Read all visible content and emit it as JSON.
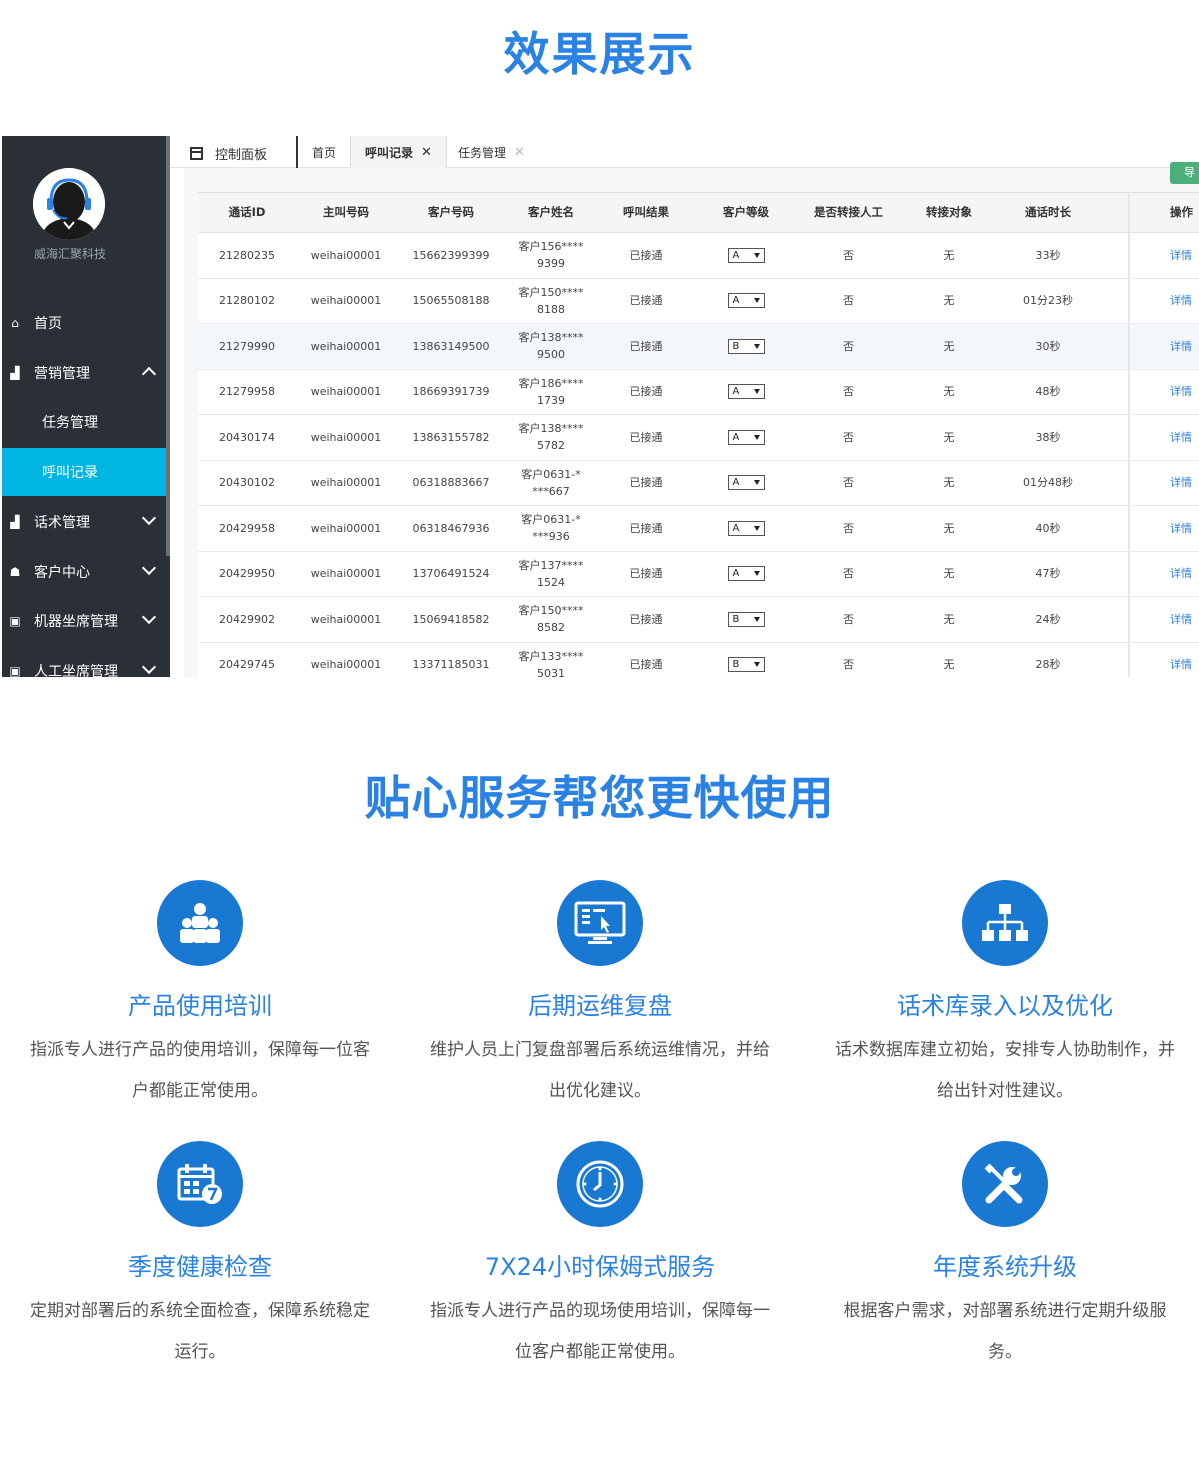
{
  "section1_title": "效果展示",
  "section2_title": "贴心服务帮您更快使用",
  "sidebar": {
    "company": "威海汇聚科技",
    "items": [
      {
        "label": "首页",
        "icon": "home-icon"
      },
      {
        "label": "营销管理",
        "icon": "chart-icon"
      },
      {
        "label": "任务管理"
      },
      {
        "label": "呼叫记录"
      },
      {
        "label": "话术管理",
        "icon": "chart-icon"
      },
      {
        "label": "客户中心",
        "icon": "users-icon"
      },
      {
        "label": "机器坐席管理",
        "icon": "robot-icon"
      },
      {
        "label": "人工坐席管理",
        "icon": "robot-icon"
      }
    ]
  },
  "tabbar": {
    "dashboard": "控制面板",
    "tabs": [
      "首页",
      "呼叫记录",
      "任务管理"
    ],
    "close_glyph": "✕",
    "green_button": "导"
  },
  "table": {
    "headers": [
      "通话ID",
      "主叫号码",
      "客户号码",
      "客户姓名",
      "呼叫结果",
      "客户等级",
      "是否转接人工",
      "转接对象",
      "通话时长",
      "操作"
    ],
    "rows": [
      {
        "id": "21280235",
        "caller": "weihai00001",
        "phone": "15662399399",
        "name1": "客户156****",
        "name2": "9399",
        "result": "已接通",
        "level": "A",
        "transfer": "否",
        "target": "无",
        "duration": "33秒",
        "action": "详情"
      },
      {
        "id": "21280102",
        "caller": "weihai00001",
        "phone": "15065508188",
        "name1": "客户150****",
        "name2": "8188",
        "result": "已接通",
        "level": "A",
        "transfer": "否",
        "target": "无",
        "duration": "01分23秒",
        "action": "详情"
      },
      {
        "id": "21279990",
        "caller": "weihai00001",
        "phone": "13863149500",
        "name1": "客户138****",
        "name2": "9500",
        "result": "已接通",
        "level": "B",
        "transfer": "否",
        "target": "无",
        "duration": "30秒",
        "action": "详情"
      },
      {
        "id": "21279958",
        "caller": "weihai00001",
        "phone": "18669391739",
        "name1": "客户186****",
        "name2": "1739",
        "result": "已接通",
        "level": "A",
        "transfer": "否",
        "target": "无",
        "duration": "48秒",
        "action": "详情"
      },
      {
        "id": "20430174",
        "caller": "weihai00001",
        "phone": "13863155782",
        "name1": "客户138****",
        "name2": "5782",
        "result": "已接通",
        "level": "A",
        "transfer": "否",
        "target": "无",
        "duration": "38秒",
        "action": "详情"
      },
      {
        "id": "20430102",
        "caller": "weihai00001",
        "phone": "06318883667",
        "name1": "客户0631-*",
        "name2": "***667",
        "result": "已接通",
        "level": "A",
        "transfer": "否",
        "target": "无",
        "duration": "01分48秒",
        "action": "详情"
      },
      {
        "id": "20429958",
        "caller": "weihai00001",
        "phone": "06318467936",
        "name1": "客户0631-*",
        "name2": "***936",
        "result": "已接通",
        "level": "A",
        "transfer": "否",
        "target": "无",
        "duration": "40秒",
        "action": "详情"
      },
      {
        "id": "20429950",
        "caller": "weihai00001",
        "phone": "13706491524",
        "name1": "客户137****",
        "name2": "1524",
        "result": "已接通",
        "level": "A",
        "transfer": "否",
        "target": "无",
        "duration": "47秒",
        "action": "详情"
      },
      {
        "id": "20429902",
        "caller": "weihai00001",
        "phone": "15069418582",
        "name1": "客户150****",
        "name2": "8582",
        "result": "已接通",
        "level": "B",
        "transfer": "否",
        "target": "无",
        "duration": "24秒",
        "action": "详情"
      },
      {
        "id": "20429745",
        "caller": "weihai00001",
        "phone": "13371185031",
        "name1": "客户133****",
        "name2": "5031",
        "result": "已接通",
        "level": "B",
        "transfer": "否",
        "target": "无",
        "duration": "28秒",
        "action": "详情"
      }
    ]
  },
  "services": [
    {
      "title": "产品使用培训",
      "desc": "指派专人进行产品的使用培训，保障每一位客户都能正常使用。",
      "icon": "team-icon"
    },
    {
      "title": "后期运维复盘",
      "desc": "维护人员上门复盘部署后系统运维情况，并给出优化建议。",
      "icon": "monitor-icon"
    },
    {
      "title": "话术库录入以及优化",
      "desc": "话术数据库建立初始，安排专人协助制作，并给出针对性建议。",
      "icon": "hierarchy-icon"
    },
    {
      "title": "季度健康检查",
      "desc": "定期对部署后的系统全面检查，保障系统稳定运行。",
      "icon": "calendar-icon"
    },
    {
      "title": "7X24小时保姆式服务",
      "desc": "指派专人进行产品的现场使用培训，保障每一位客户都能正常使用。",
      "icon": "clock-icon"
    },
    {
      "title": "年度系统升级",
      "desc": "根据客户需求，对部署系统进行定期升级服务。",
      "icon": "tools-icon"
    }
  ]
}
